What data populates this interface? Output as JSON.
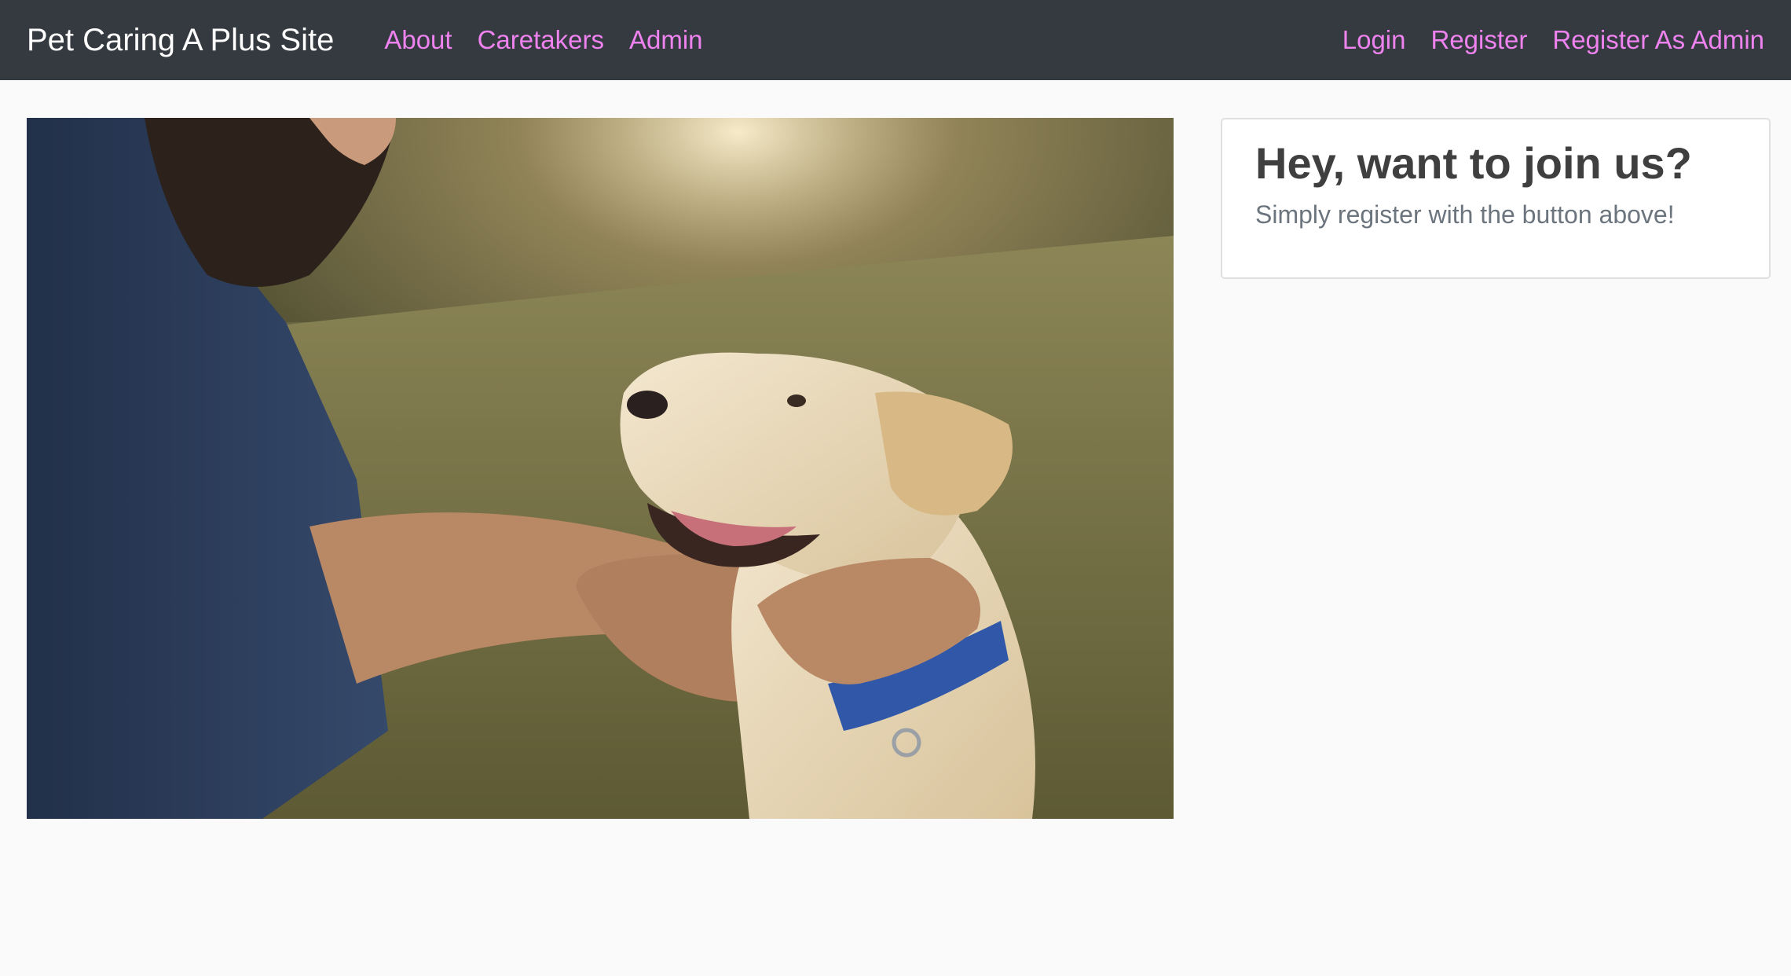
{
  "navbar": {
    "brand": "Pet Caring A Plus Site",
    "left_links": [
      "About",
      "Caretakers",
      "Admin"
    ],
    "right_links": [
      "Login",
      "Register",
      "Register As Admin"
    ]
  },
  "hero": {
    "icon": "photo-man-petting-dog"
  },
  "join_card": {
    "title": "Hey, want to join us?",
    "text": "Simply register with the button above!"
  },
  "colors": {
    "navbar_bg": "#343a40",
    "nav_link": "#ee82ee",
    "page_bg": "#fafafa"
  }
}
